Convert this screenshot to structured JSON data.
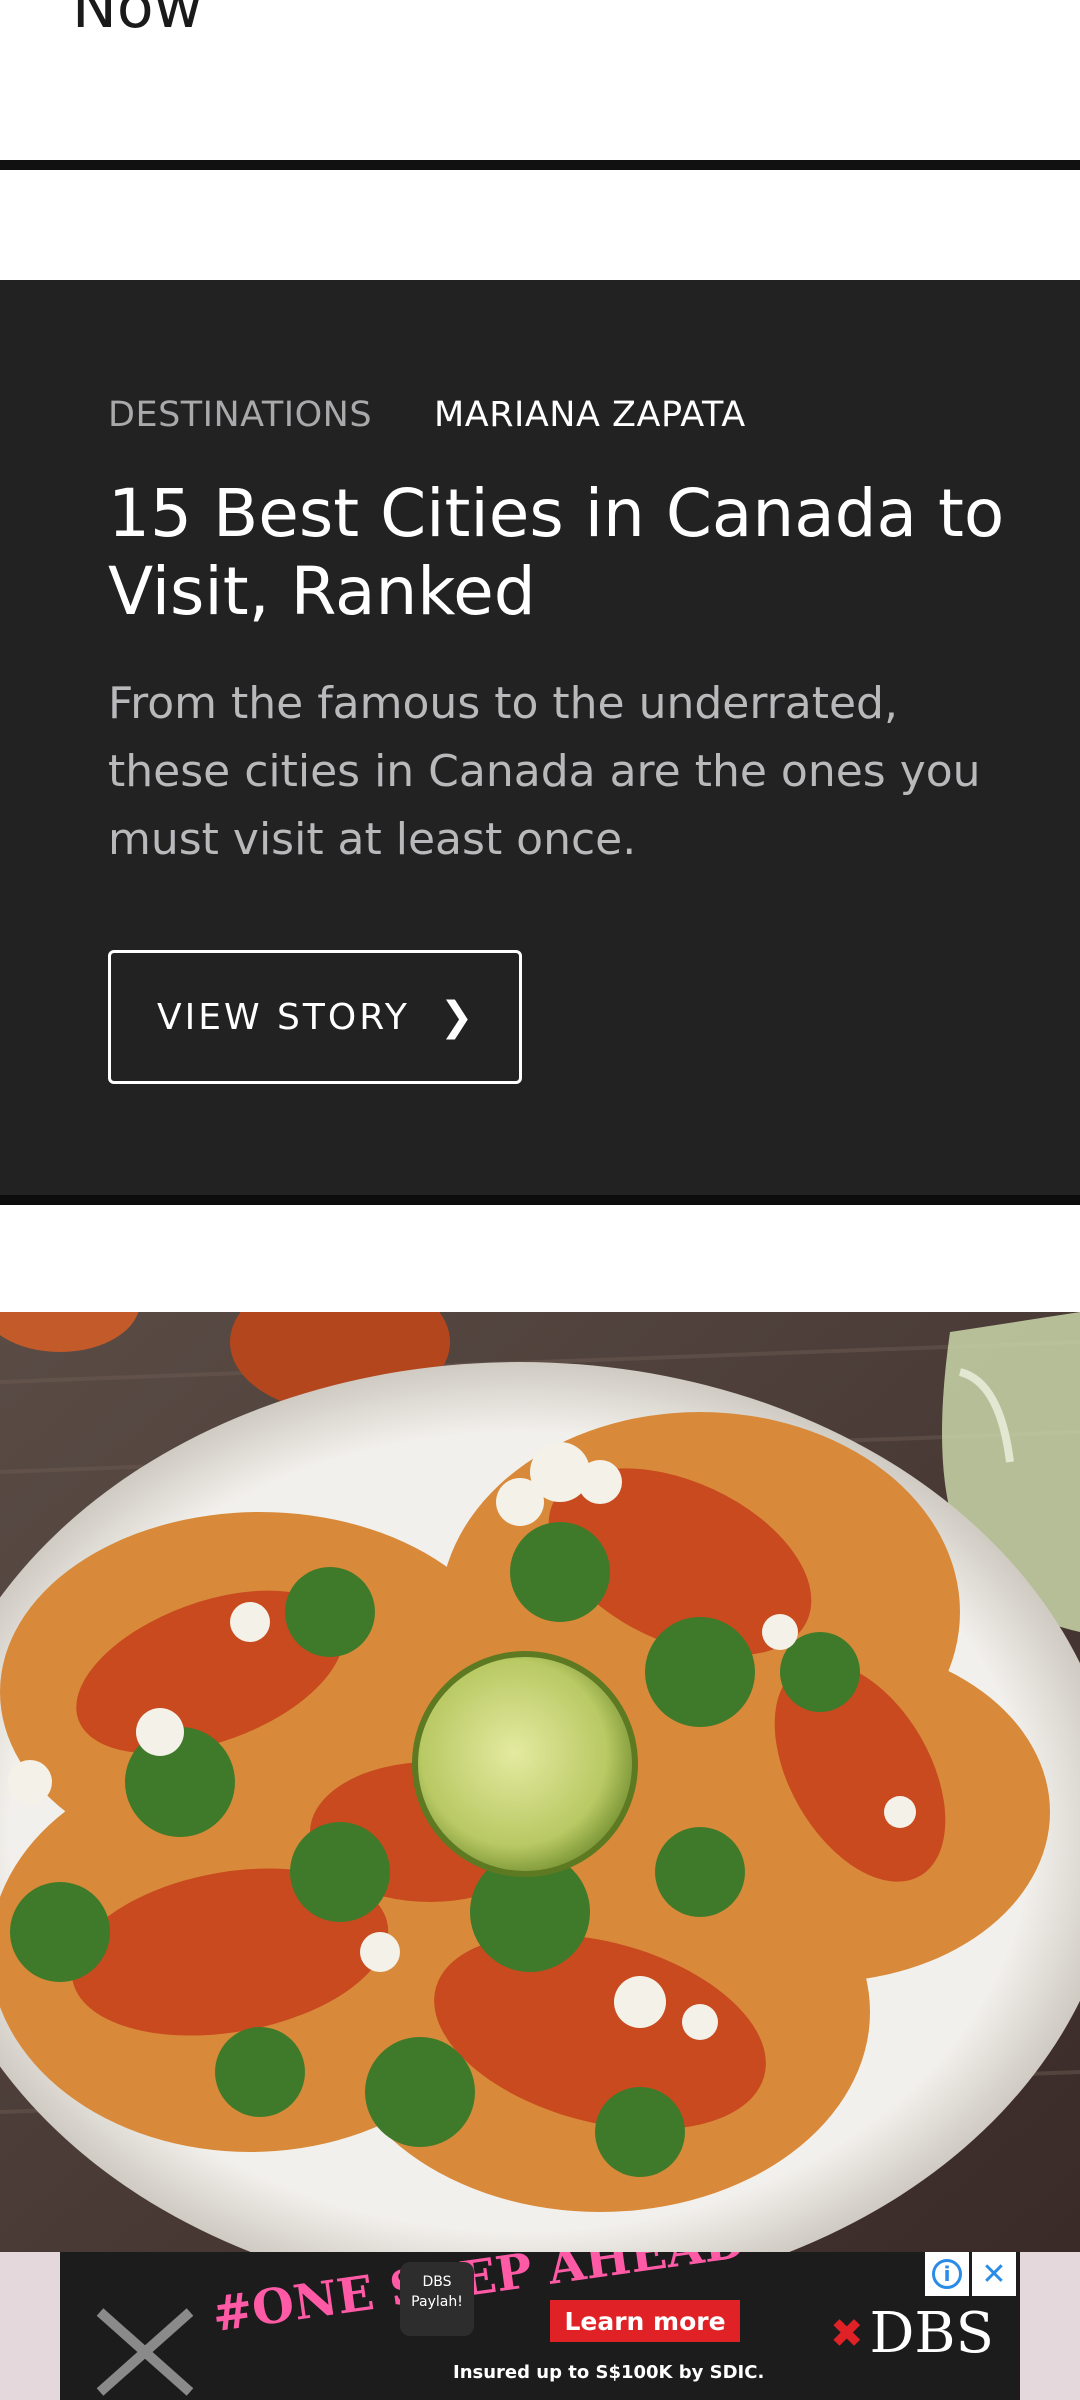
{
  "previous_story": {
    "headline_tail": "Now"
  },
  "story": {
    "category": "DESTINATIONS",
    "author": "MARIANA ZAPATA",
    "title": "15 Best Cities in Canada to Visit, Ranked",
    "description": "From the famous to the underrated, these cities in Canada are the ones you must visit at least once.",
    "cta_label": "VIEW STORY",
    "cta_icon": "chevron-right-icon",
    "cta_glyph": "❯"
  },
  "next_story": {
    "image_subject": "tacos-plate-photo"
  },
  "ad": {
    "slogan": "#ONE STEP AHEAD",
    "badge_text": "DBS Paylah!",
    "cta_label": "Learn more",
    "disclaimer": "Insured up to S$100K by SDIC.",
    "brand": "DBS",
    "brand_glyph": "✖",
    "info_glyph": "i",
    "close_glyph": "✕",
    "colors": {
      "brand_red": "#e02226",
      "slogan_pink": "#ff5aa5",
      "icon_blue": "#2a8ce6"
    }
  }
}
